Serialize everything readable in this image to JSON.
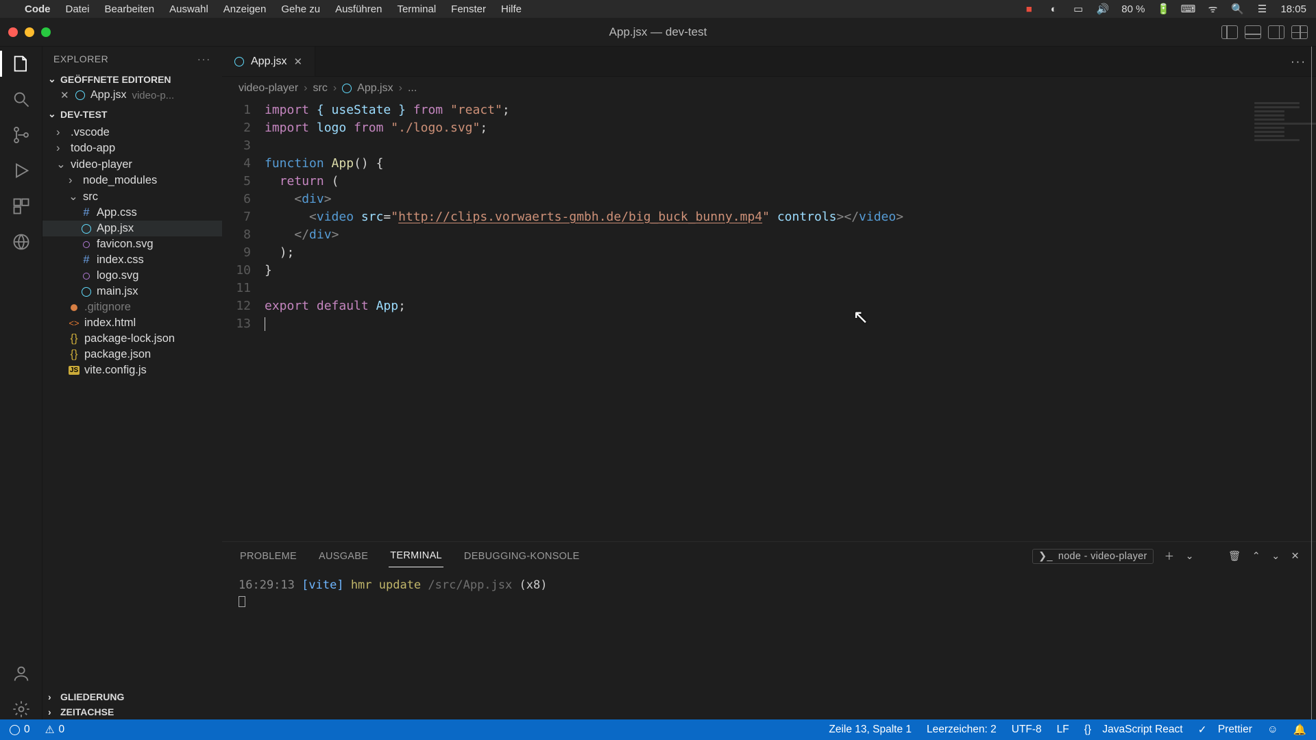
{
  "mac_menu": {
    "app": "Code",
    "items": [
      "Datei",
      "Bearbeiten",
      "Auswahl",
      "Anzeigen",
      "Gehe zu",
      "Ausführen",
      "Terminal",
      "Fenster",
      "Hilfe"
    ],
    "battery": "80 %",
    "clock": "18:05"
  },
  "window": {
    "title": "App.jsx — dev-test"
  },
  "explorer": {
    "title": "EXPLORER",
    "open_editors_label": "GEÖFFNETE EDITOREN",
    "open_editor": {
      "file": "App.jsx",
      "folder": "video-p..."
    },
    "project": "DEV-TEST",
    "tree": {
      "vscode": ".vscode",
      "todo": "todo-app",
      "vp": "video-player",
      "vp_node": "node_modules",
      "vp_src": "src",
      "appcss": "App.css",
      "appjsx": "App.jsx",
      "favicon": "favicon.svg",
      "indexcss": "index.css",
      "logosvg": "logo.svg",
      "mainjsx": "main.jsx",
      "gitignore": ".gitignore",
      "indexhtml": "index.html",
      "pkglock": "package-lock.json",
      "pkg": "package.json",
      "vite": "vite.config.js"
    },
    "outline": "GLIEDERUNG",
    "timeline": "ZEITACHSE"
  },
  "tab": {
    "label": "App.jsx"
  },
  "breadcrumb": {
    "a": "video-player",
    "b": "src",
    "c": "App.jsx",
    "d": "..."
  },
  "code": {
    "l1a": "import",
    "l1b": "{ useState }",
    "l1c": "from",
    "l1d": "\"react\"",
    "l1e": ";",
    "l2a": "import",
    "l2b": "logo",
    "l2c": "from",
    "l2d": "\"./logo.svg\"",
    "l2e": ";",
    "l4a": "function",
    "l4b": "App",
    "l4c": "() {",
    "l5a": "return",
    "l5b": "(",
    "l6a": "<",
    "l6b": "div",
    "l6c": ">",
    "l7a": "<",
    "l7b": "video",
    "l7c": "src",
    "l7d": "=",
    "l7e": "\"",
    "l7f": "http://clips.vorwaerts-gmbh.de/big_buck_bunny.mp4",
    "l7g": "\"",
    "l7h": "controls",
    "l7i": "></",
    "l7j": "video",
    "l7k": ">",
    "l8a": "</",
    "l8b": "div",
    "l8c": ">",
    "l9a": ");",
    "l10a": "}",
    "l12a": "export",
    "l12b": "default",
    "l12c": "App",
    "l12d": ";"
  },
  "line_numbers": [
    "1",
    "2",
    "3",
    "4",
    "5",
    "6",
    "7",
    "8",
    "9",
    "10",
    "11",
    "12",
    "13"
  ],
  "panel": {
    "tabs": {
      "problems": "PROBLEME",
      "output": "AUSGABE",
      "terminal": "TERMINAL",
      "debug": "DEBUGGING-KONSOLE"
    },
    "term_label": "node - video-player",
    "term_line": {
      "time": "16:29:13",
      "vite": "[vite]",
      "cmd": "hmr update",
      "path": "/src/App.jsx",
      "count": "(x8)"
    }
  },
  "status": {
    "errors": "0",
    "warnings": "0",
    "cursor": "Zeile 13, Spalte 1",
    "spaces": "Leerzeichen: 2",
    "encoding": "UTF-8",
    "eol": "LF",
    "lang": "JavaScript React",
    "prettier": "Prettier"
  }
}
